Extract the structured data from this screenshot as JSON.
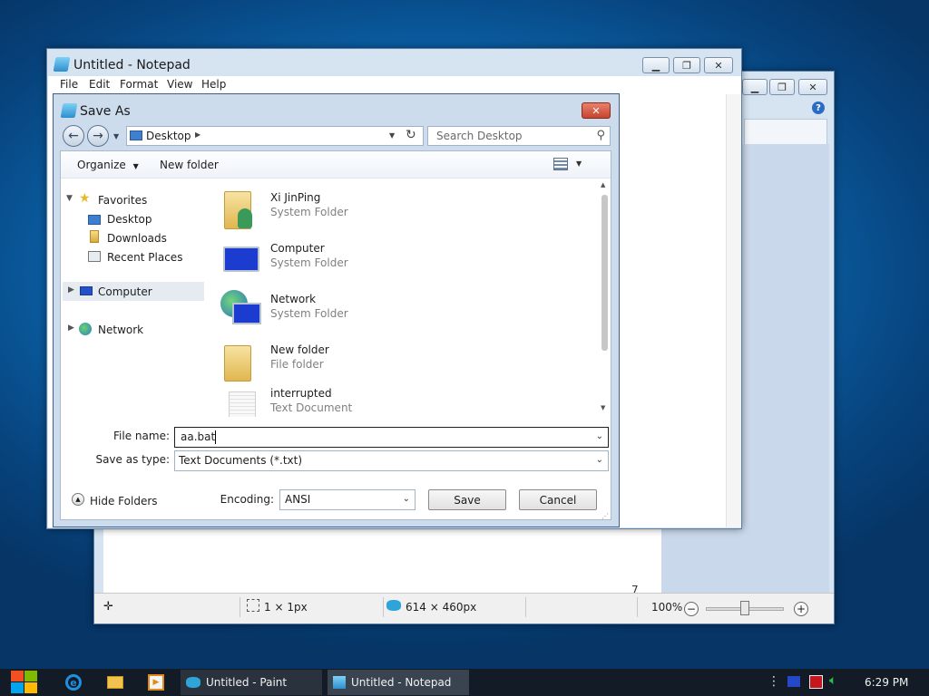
{
  "paint": {
    "status_dimensions": "1 × 1px",
    "status_image_size": "614 × 460px",
    "zoom_level": "100%",
    "canvas_edge_text": "7"
  },
  "notepad": {
    "title": "Untitled - Notepad",
    "menu": [
      "File",
      "Edit",
      "Format",
      "View",
      "Help"
    ]
  },
  "save_as": {
    "title": "Save As",
    "breadcrumb": "Desktop",
    "search_placeholder": "Search Desktop",
    "toolbar": {
      "organize": "Organize",
      "new_folder": "New folder"
    },
    "nav": {
      "favorites": "Favorites",
      "favorites_items": [
        "Desktop",
        "Downloads",
        "Recent Places"
      ],
      "computer": "Computer",
      "network": "Network"
    },
    "files": [
      {
        "name": "Xi JinPing",
        "type": "System Folder",
        "icon": "user-folder-icon"
      },
      {
        "name": "Computer",
        "type": "System Folder",
        "icon": "computer-icon"
      },
      {
        "name": "Network",
        "type": "System Folder",
        "icon": "network-icon"
      },
      {
        "name": "New folder",
        "type": "File folder",
        "icon": "folder-icon"
      },
      {
        "name": "interrupted",
        "type": "Text Document",
        "icon": "text-document-icon"
      }
    ],
    "file_name_label": "File name:",
    "file_name_value": "aa.bat",
    "save_type_label": "Save as type:",
    "save_type_value": "Text Documents (*.txt)",
    "hide_folders": "Hide Folders",
    "encoding_label": "Encoding:",
    "encoding_value": "ANSI",
    "save_button": "Save",
    "cancel_button": "Cancel"
  },
  "taskbar": {
    "paint_task": "Untitled - Paint",
    "notepad_task": "Untitled - Notepad",
    "clock": "6:29 PM"
  }
}
